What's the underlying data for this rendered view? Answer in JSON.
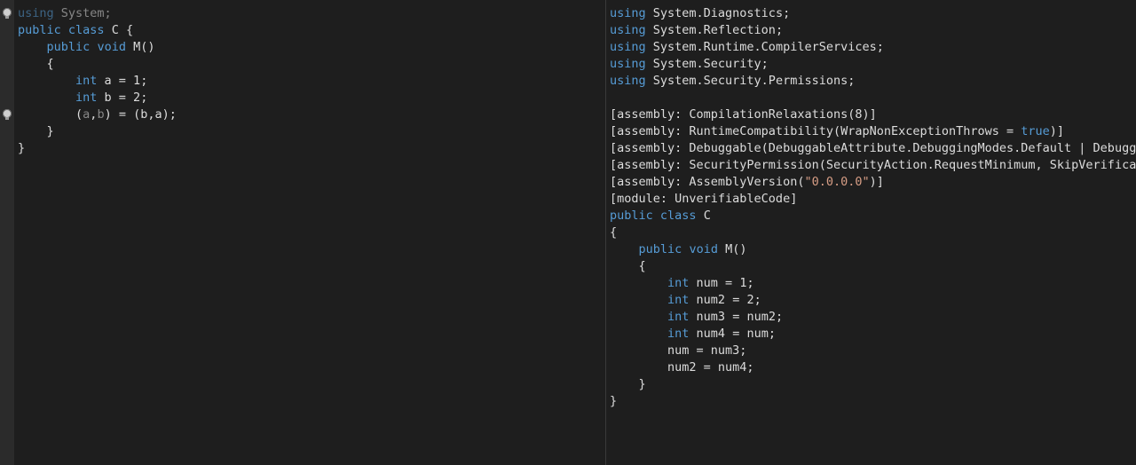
{
  "colors": {
    "background": "#1e1e1e",
    "gutter": "#2b2b2b",
    "text": "#dcdcdc",
    "keyword": "#569cd6",
    "string": "#d69d85"
  },
  "gutter_icons": [
    "lightbulb-icon",
    "lightbulb-icon"
  ],
  "left_code": [
    [
      {
        "t": "using",
        "k": "kw",
        "f": 1
      },
      {
        "t": " System;",
        "f": 1
      }
    ],
    [
      {
        "t": "public",
        "k": "kw"
      },
      {
        "t": " "
      },
      {
        "t": "class",
        "k": "kw"
      },
      {
        "t": " C {"
      }
    ],
    [
      {
        "t": "    "
      },
      {
        "t": "public",
        "k": "kw"
      },
      {
        "t": " "
      },
      {
        "t": "void",
        "k": "kw"
      },
      {
        "t": " M()"
      }
    ],
    [
      {
        "t": "    {"
      }
    ],
    [
      {
        "t": "        "
      },
      {
        "t": "int",
        "k": "kw"
      },
      {
        "t": " a = 1;"
      }
    ],
    [
      {
        "t": "        "
      },
      {
        "t": "int",
        "k": "kw"
      },
      {
        "t": " b = 2;"
      }
    ],
    [
      {
        "t": "        ("
      },
      {
        "t": "a",
        "f": 1
      },
      {
        "t": ","
      },
      {
        "t": "b",
        "f": 1
      },
      {
        "t": ") = (b,a);"
      }
    ],
    [
      {
        "t": "    }"
      }
    ],
    [
      {
        "t": "}"
      }
    ]
  ],
  "right_code": [
    [
      {
        "t": "using",
        "k": "kw"
      },
      {
        "t": " System.Diagnostics;"
      }
    ],
    [
      {
        "t": "using",
        "k": "kw"
      },
      {
        "t": " System.Reflection;"
      }
    ],
    [
      {
        "t": "using",
        "k": "kw"
      },
      {
        "t": " System.Runtime.CompilerServices;"
      }
    ],
    [
      {
        "t": "using",
        "k": "kw"
      },
      {
        "t": " System.Security;"
      }
    ],
    [
      {
        "t": "using",
        "k": "kw"
      },
      {
        "t": " System.Security.Permissions;"
      }
    ],
    [
      {
        "t": ""
      }
    ],
    [
      {
        "t": "[assembly: CompilationRelaxations(8)]"
      }
    ],
    [
      {
        "t": "[assembly: RuntimeCompatibility(WrapNonExceptionThrows = "
      },
      {
        "t": "true",
        "k": "kw"
      },
      {
        "t": ")]"
      }
    ],
    [
      {
        "t": "[assembly: Debuggable(DebuggableAttribute.DebuggingModes.Default | Debugg"
      }
    ],
    [
      {
        "t": "[assembly: SecurityPermission(SecurityAction.RequestMinimum, SkipVerifica"
      }
    ],
    [
      {
        "t": "[assembly: AssemblyVersion("
      },
      {
        "t": "\"0.0.0.0\"",
        "k": "str"
      },
      {
        "t": ")]"
      }
    ],
    [
      {
        "t": "[module: UnverifiableCode]"
      }
    ],
    [
      {
        "t": "public",
        "k": "kw"
      },
      {
        "t": " "
      },
      {
        "t": "class",
        "k": "kw"
      },
      {
        "t": " C"
      }
    ],
    [
      {
        "t": "{"
      }
    ],
    [
      {
        "t": "    "
      },
      {
        "t": "public",
        "k": "kw"
      },
      {
        "t": " "
      },
      {
        "t": "void",
        "k": "kw"
      },
      {
        "t": " M()"
      }
    ],
    [
      {
        "t": "    {"
      }
    ],
    [
      {
        "t": "        "
      },
      {
        "t": "int",
        "k": "kw"
      },
      {
        "t": " num = 1;"
      }
    ],
    [
      {
        "t": "        "
      },
      {
        "t": "int",
        "k": "kw"
      },
      {
        "t": " num2 = 2;"
      }
    ],
    [
      {
        "t": "        "
      },
      {
        "t": "int",
        "k": "kw"
      },
      {
        "t": " num3 = num2;"
      }
    ],
    [
      {
        "t": "        "
      },
      {
        "t": "int",
        "k": "kw"
      },
      {
        "t": " num4 = num;"
      }
    ],
    [
      {
        "t": "        num = num3;"
      }
    ],
    [
      {
        "t": "        num2 = num4;"
      }
    ],
    [
      {
        "t": "    }"
      }
    ],
    [
      {
        "t": "}"
      }
    ]
  ]
}
